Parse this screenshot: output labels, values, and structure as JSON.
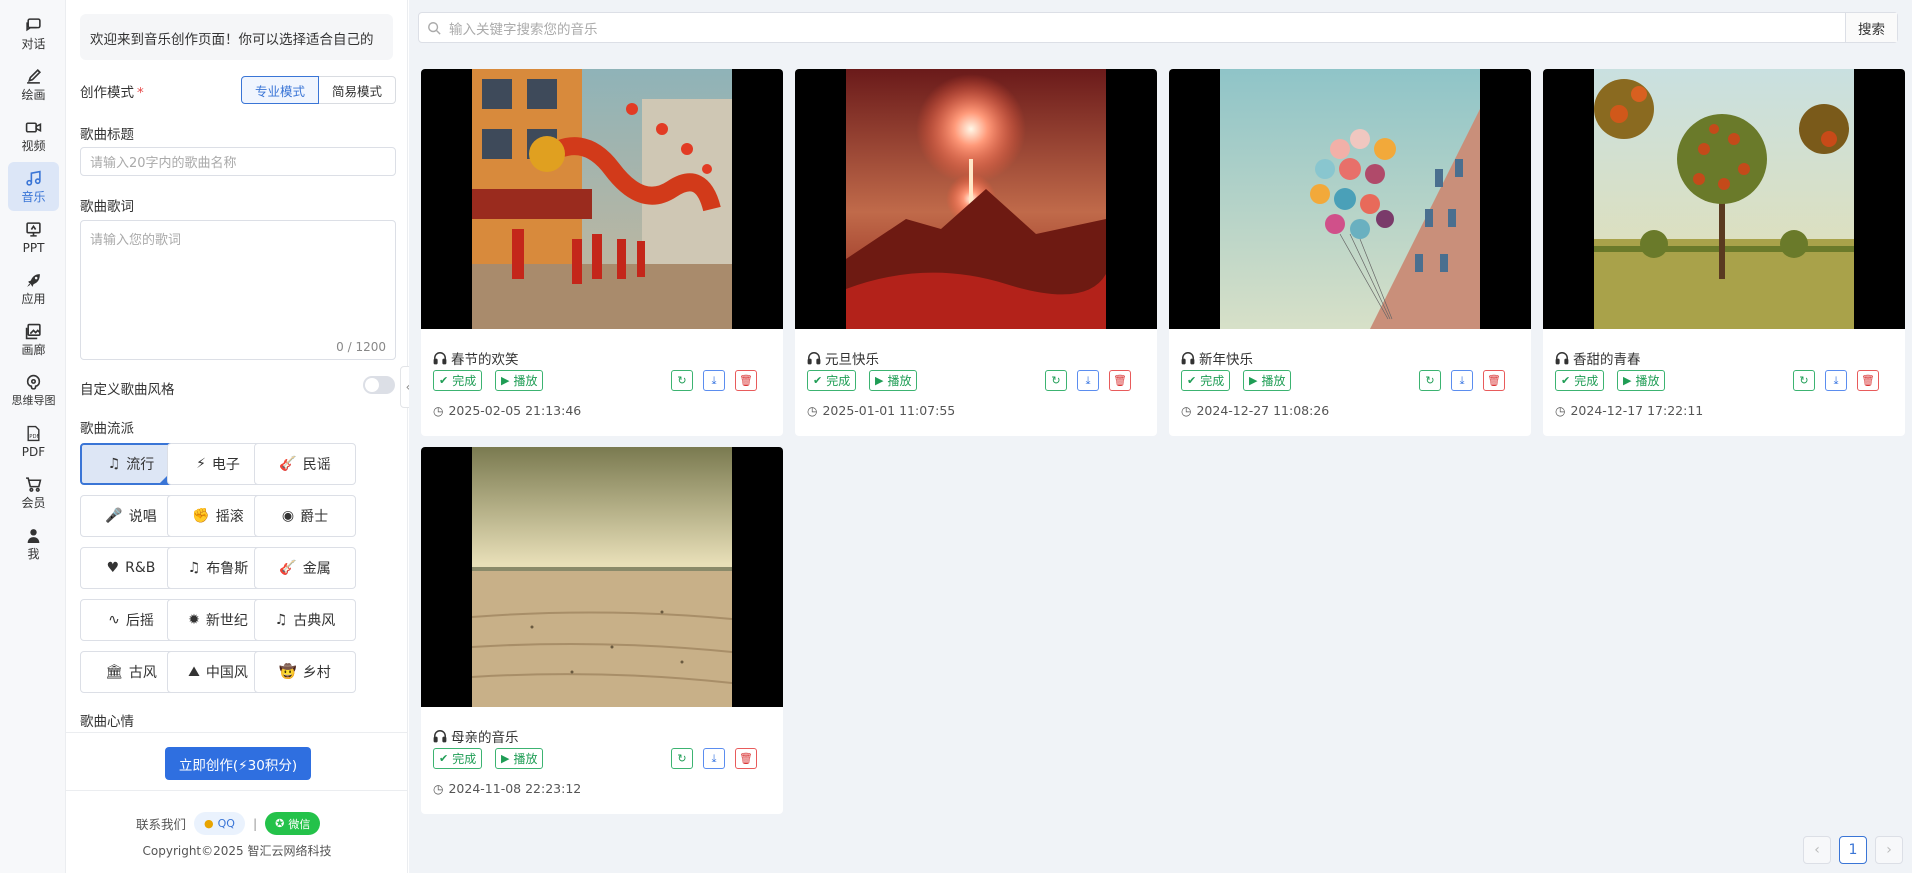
{
  "nav": [
    {
      "label": "对话",
      "icon": "chat-icon"
    },
    {
      "label": "绘画",
      "icon": "brush-icon"
    },
    {
      "label": "视频",
      "icon": "video-icon"
    },
    {
      "label": "音乐",
      "icon": "music-icon",
      "active": true
    },
    {
      "label": "PPT",
      "icon": "presentation-icon"
    },
    {
      "label": "应用",
      "icon": "rocket-icon"
    },
    {
      "label": "画廊",
      "icon": "gallery-icon"
    },
    {
      "label": "思维导图",
      "icon": "mindmap-icon"
    },
    {
      "label": "PDF",
      "icon": "pdf-icon"
    },
    {
      "label": "会员",
      "icon": "cart-icon"
    },
    {
      "label": "我",
      "icon": "user-icon"
    }
  ],
  "panel": {
    "welcome": "欢迎来到音乐创作页面！你可以选择适合自己的",
    "mode_label": "创作模式",
    "required_mark": "*",
    "mode_pro": "专业模式",
    "mode_simple": "简易模式",
    "title_label": "歌曲标题",
    "title_placeholder": "请输入20字内的歌曲名称",
    "lyrics_label": "歌曲歌词",
    "lyrics_placeholder": "请输入您的歌词",
    "lyrics_counter": "0 / 1200",
    "custom_style_label": "自定义歌曲风格",
    "genre_label": "歌曲流派",
    "genres": [
      {
        "label": "流行",
        "glyph": "♫",
        "icon": "music-note-icon",
        "selected": true
      },
      {
        "label": "电子",
        "glyph": "⚡",
        "icon": "bolt-icon"
      },
      {
        "label": "民谣",
        "glyph": "🎸",
        "icon": "guitar-icon"
      },
      {
        "label": "说唱",
        "glyph": "🎤",
        "icon": "microphone-icon"
      },
      {
        "label": "摇滚",
        "glyph": "✊",
        "icon": "fist-icon"
      },
      {
        "label": "爵士",
        "glyph": "◉",
        "icon": "record-icon"
      },
      {
        "label": "R&B",
        "glyph": "♥",
        "icon": "heart-icon"
      },
      {
        "label": "布鲁斯",
        "glyph": "♫",
        "icon": "music-note-icon"
      },
      {
        "label": "金属",
        "glyph": "🎸",
        "icon": "guitar-icon"
      },
      {
        "label": "后摇",
        "glyph": "∿",
        "icon": "wave-icon"
      },
      {
        "label": "新世纪",
        "glyph": "✹",
        "icon": "sun-icon"
      },
      {
        "label": "古典风",
        "glyph": "♫",
        "icon": "music-note-icon"
      },
      {
        "label": "古风",
        "glyph": "🏛",
        "icon": "temple-icon"
      },
      {
        "label": "中国风",
        "glyph": "⛰",
        "icon": "mountain-icon"
      },
      {
        "label": "乡村",
        "glyph": "🤠",
        "icon": "cowboy-hat-icon"
      }
    ],
    "mood_label": "歌曲心情",
    "create_button": "立即创作(⚡30积分)",
    "contact_label": "联系我们",
    "qq_label": "QQ",
    "separator": "|",
    "wechat_label": "微信",
    "copyright": "Copyright©2025 智汇云网络科技"
  },
  "search": {
    "placeholder": "输入关键字搜索您的音乐",
    "button": "搜索"
  },
  "cards": [
    {
      "title": "春节的欢笑",
      "status": "完成",
      "play": "播放",
      "time": "2025-02-05 21:13:46",
      "art": "dragon-parade"
    },
    {
      "title": "元旦快乐",
      "status": "完成",
      "play": "播放",
      "time": "2025-01-01 11:07:55",
      "art": "fireworks-mountain"
    },
    {
      "title": "新年快乐",
      "status": "完成",
      "play": "播放",
      "time": "2024-12-27 11:08:26",
      "art": "balloons-building"
    },
    {
      "title": "香甜的青春",
      "status": "完成",
      "play": "播放",
      "time": "2024-12-17 17:22:11",
      "art": "fruit-orchard"
    },
    {
      "title": "母亲的音乐",
      "status": "完成",
      "play": "播放",
      "time": "2024-11-08 22:23:12",
      "art": "beach-sand"
    }
  ],
  "pagination": {
    "prev": "‹",
    "current": "1",
    "next": "›"
  },
  "colors": {
    "accent": "#2f6fe0",
    "success": "#1f9d55",
    "danger": "#d93636",
    "page_bg": "#f0f3f7"
  }
}
